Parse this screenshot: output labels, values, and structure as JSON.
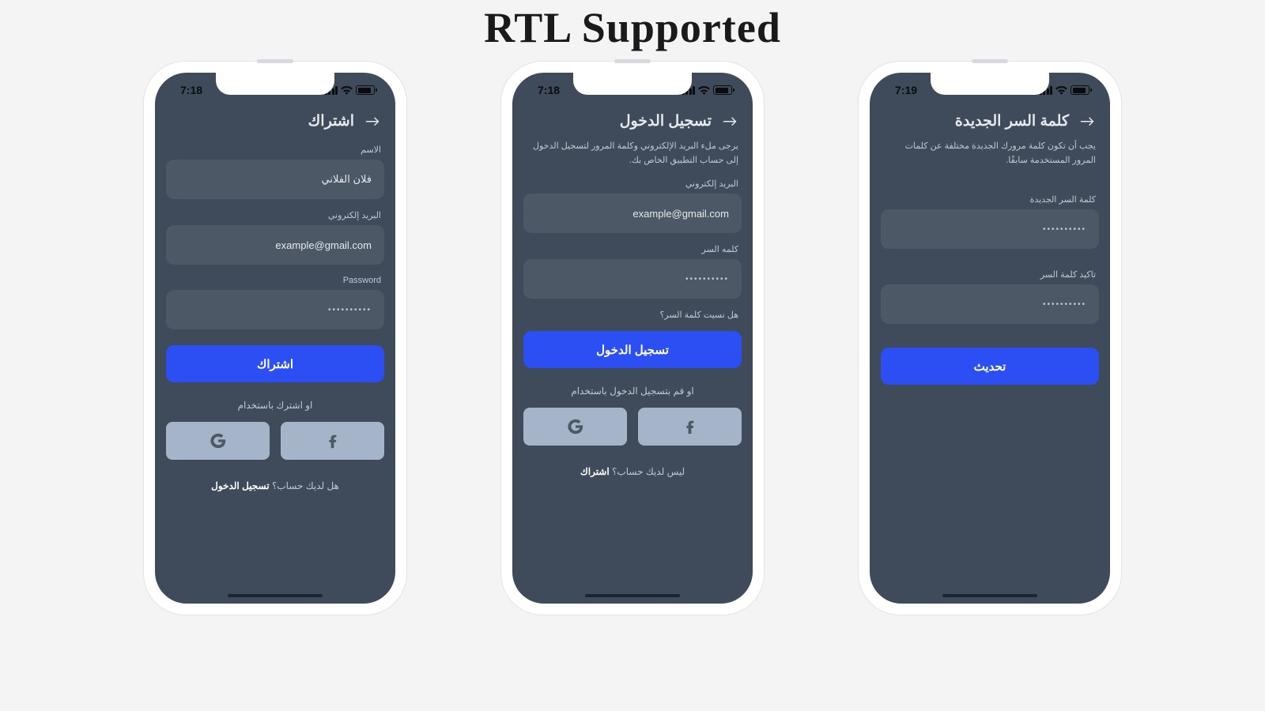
{
  "page": {
    "title": "RTL Supported"
  },
  "phones": [
    {
      "time": "7:18",
      "header": "اشتراك",
      "subtitle": "",
      "fields": [
        {
          "label": "الاسم",
          "value": "فلان الفلاني",
          "kind": "text"
        },
        {
          "label": "البريد إلكتروني",
          "value": "example@gmail.com",
          "kind": "email"
        },
        {
          "label": "Password",
          "value": "••••••••••",
          "kind": "pass"
        }
      ],
      "small_link": "",
      "primary": "اشتراك",
      "divider": "او اشترك باستخدام",
      "show_social": true,
      "footer_q": "هل لديك حساب؟",
      "footer_a": "تسجيل الدخول"
    },
    {
      "time": "7:18",
      "header": "تسجيل الدخول",
      "subtitle": "يرجى ملء البريد الإلكتروني وكلمة المرور لتسجيل الدخول إلى حساب التطبيق الخاص بك.",
      "fields": [
        {
          "label": "البريد إلكتروني",
          "value": "example@gmail.com",
          "kind": "email"
        },
        {
          "label": "كلمه السر",
          "value": "••••••••••",
          "kind": "pass"
        }
      ],
      "small_link": "هل نسيت كلمة السر؟",
      "primary": "تسجيل الدخول",
      "divider": "او قم بتسجيل الدخول باستخدام",
      "show_social": true,
      "footer_q": "ليس لديك حساب؟",
      "footer_a": "اشتراك"
    },
    {
      "time": "7:19",
      "header": "كلمة السر الجديدة",
      "subtitle": "يجب أن تكون كلمة مرورك الجديدة مختلفة عن كلمات المرور المستخدمة سابقًا.",
      "fields": [
        {
          "label": "كلمة السر الجديدة",
          "value": "••••••••••",
          "kind": "pass"
        },
        {
          "label": "تاكيد كلمة السر",
          "value": "••••••••••",
          "kind": "pass"
        }
      ],
      "small_link": "",
      "primary": "تحديث",
      "divider": "",
      "show_social": false,
      "footer_q": "",
      "footer_a": ""
    }
  ],
  "icons": {
    "google": "google-icon",
    "facebook": "facebook-icon",
    "back": "arrow-right-icon"
  }
}
